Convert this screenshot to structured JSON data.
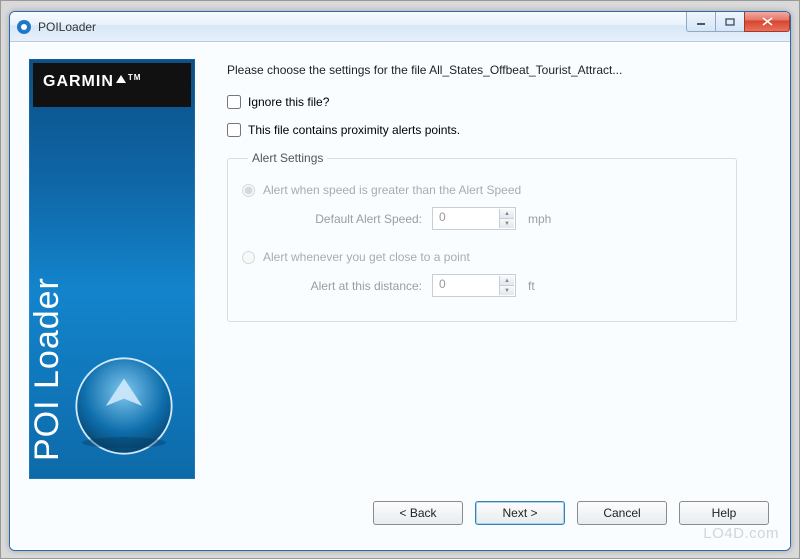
{
  "window": {
    "title": "POILoader"
  },
  "sidebar": {
    "brand": "GARMIN",
    "tm": "TM",
    "product": "POI Loader"
  },
  "main": {
    "instruction": "Please choose the settings for the file All_States_Offbeat_Tourist_Attract...",
    "ignore_label": "Ignore this file?",
    "proximity_label": "This file contains proximity alerts points.",
    "alert_legend": "Alert Settings",
    "radio_speed_label": "Alert when speed is greater than the Alert Speed",
    "default_speed_label": "Default Alert Speed:",
    "default_speed_value": "0",
    "speed_unit": "mph",
    "radio_distance_label": "Alert whenever you get close to a point",
    "distance_label": "Alert at this distance:",
    "distance_value": "0",
    "distance_unit": "ft"
  },
  "buttons": {
    "back": "< Back",
    "next": "Next >",
    "cancel": "Cancel",
    "help": "Help"
  },
  "watermark": "LO4D.com"
}
